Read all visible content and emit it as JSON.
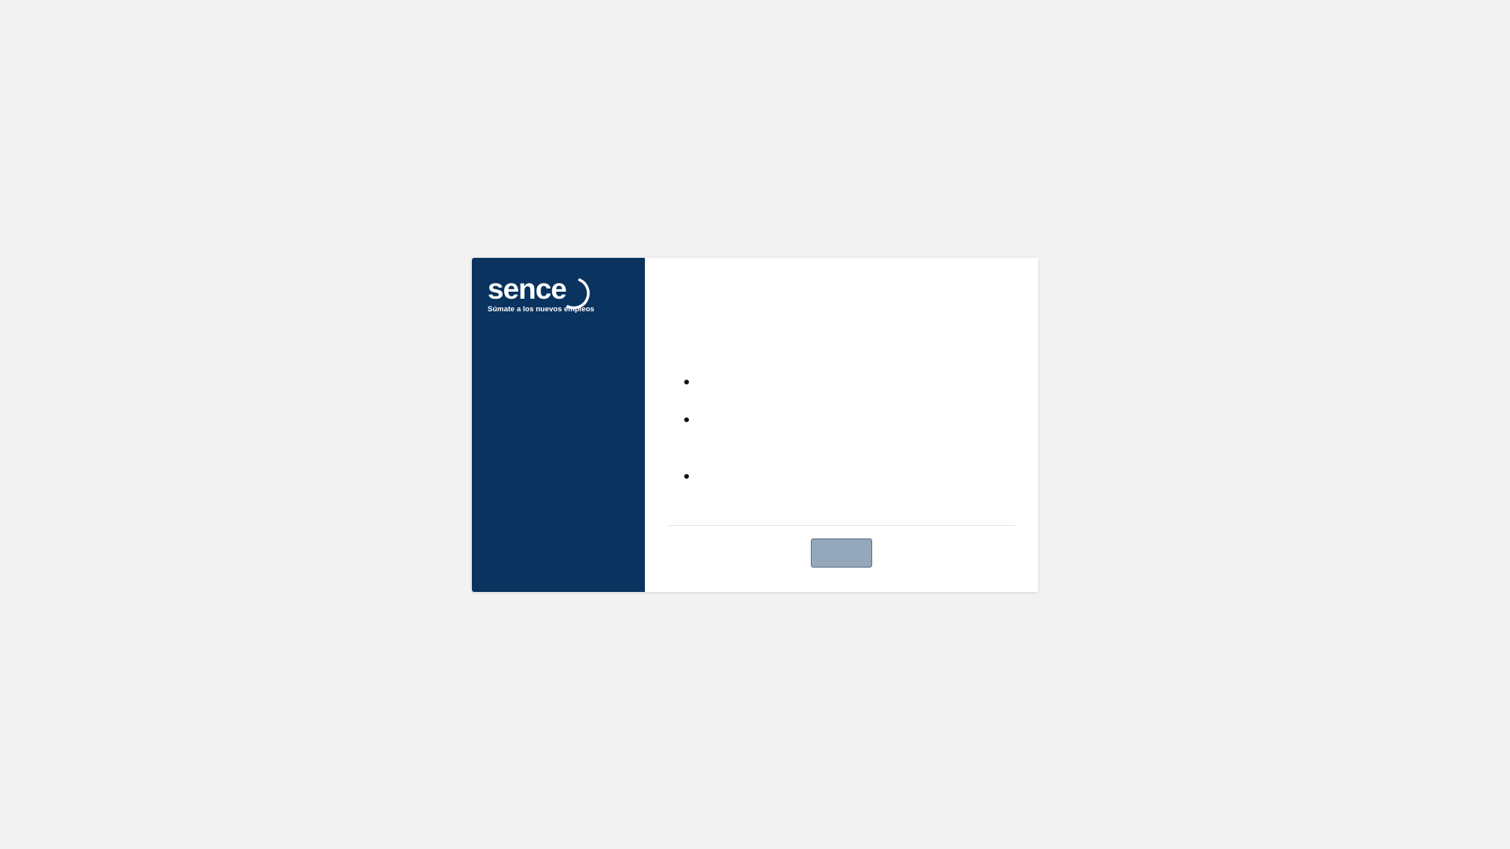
{
  "brand": {
    "name": "sence",
    "tagline": "Súmate a los nuevos empleos"
  },
  "colors": {
    "background": "#f2f2f2",
    "sidebar": "#0a335f",
    "button": "#94a7bb",
    "button_border": "#5c6f86"
  },
  "content": {
    "bullet_items": [
      "",
      "",
      ""
    ]
  },
  "footer": {
    "button_label": ""
  }
}
